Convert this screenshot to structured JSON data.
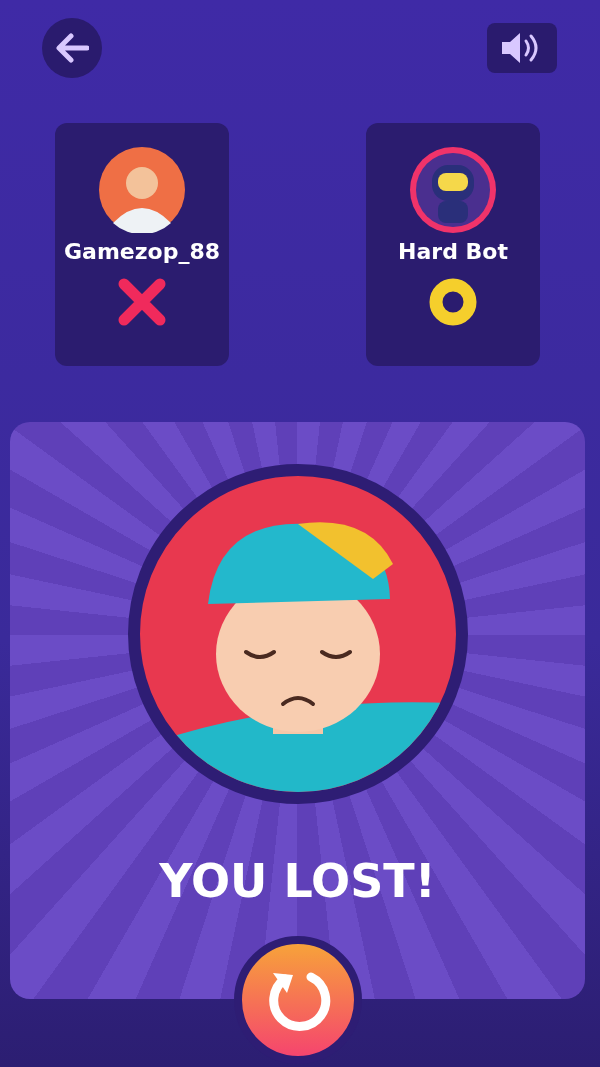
{
  "players": [
    {
      "name": "Gamezop_88",
      "kind": "cross"
    },
    {
      "name": "Hard Bot",
      "kind": "ring"
    }
  ],
  "result": {
    "title": "YOU LOST!"
  }
}
